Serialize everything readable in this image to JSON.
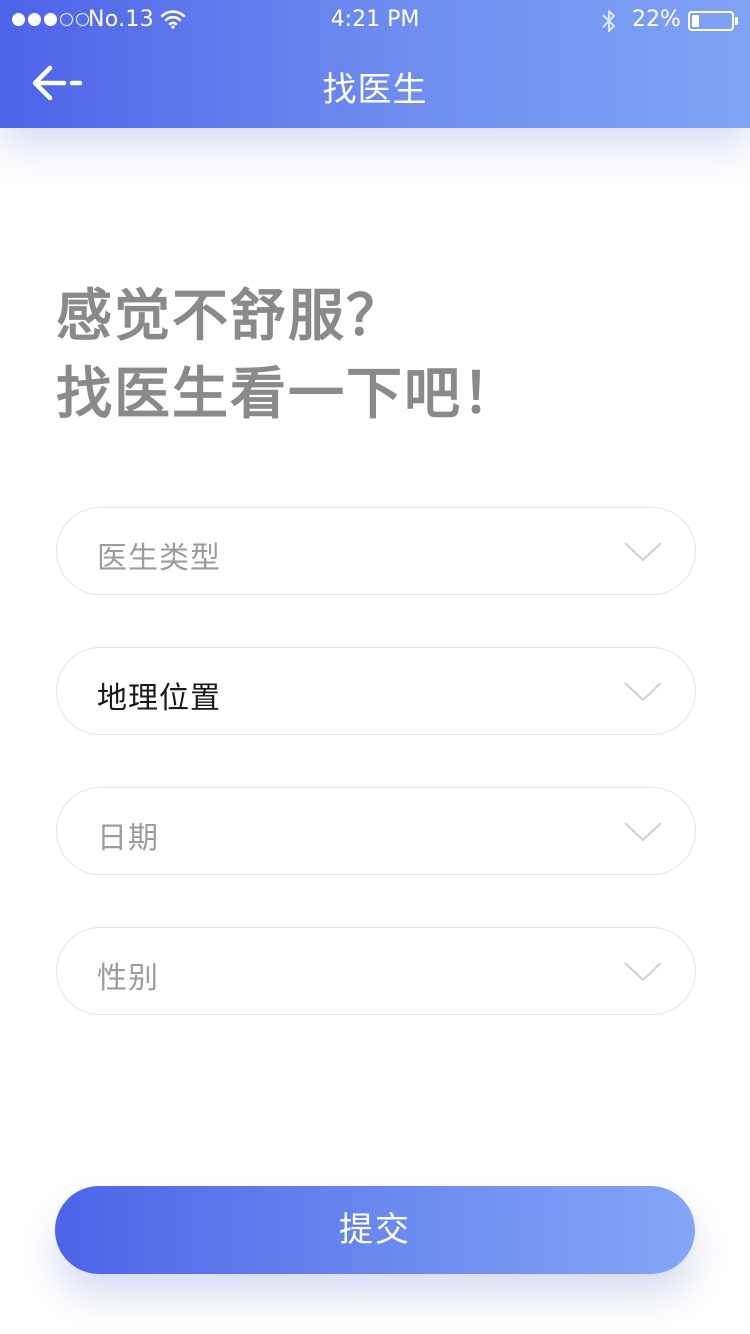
{
  "status_bar": {
    "carrier": "No.13",
    "time": "4:21 PM",
    "battery_percent": "22%",
    "icons": [
      "signal-dots-icon",
      "wifi-icon",
      "bluetooth-icon",
      "battery-icon"
    ]
  },
  "nav": {
    "title": "找医生",
    "back_icon": "arrow-left-icon"
  },
  "headline": {
    "line1": "感觉不舒服？",
    "line2": "找医生看一下吧！"
  },
  "form": {
    "fields": [
      {
        "label": "医生类型",
        "filled": false,
        "icon": "chevron-down-icon"
      },
      {
        "label": "地理位置",
        "filled": true,
        "icon": "chevron-down-icon"
      },
      {
        "label": "日期",
        "filled": false,
        "icon": "chevron-down-icon"
      },
      {
        "label": "性别",
        "filled": false,
        "icon": "chevron-down-icon"
      }
    ]
  },
  "submit": {
    "label": "提交"
  },
  "colors": {
    "gradient_start": "#4d63e8",
    "gradient_end": "#80a3f6",
    "headline": "#8a8a8a",
    "placeholder": "#9c9c9c",
    "value": "#1a1a1a",
    "field_border": "#e6e6ea"
  }
}
